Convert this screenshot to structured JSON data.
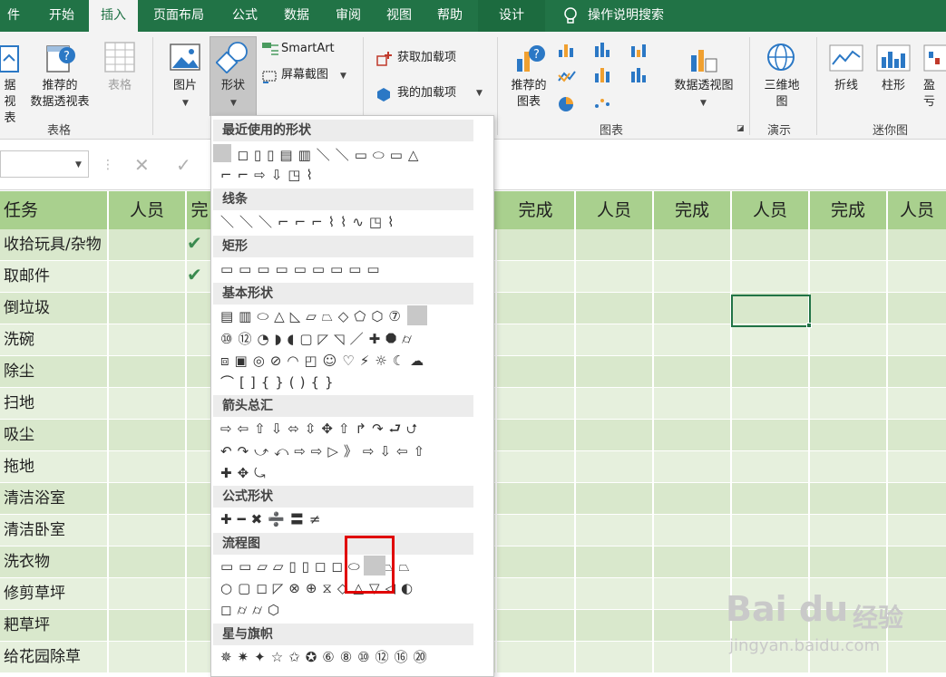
{
  "ribbon_tabs": [
    "件",
    "开始",
    "插入",
    "页面布局",
    "公式",
    "数据",
    "审阅",
    "视图",
    "帮助",
    "设计"
  ],
  "tell_me": "操作说明搜索",
  "ribbon": {
    "tables_group": {
      "pivot_partial_line1": "据",
      "pivot_partial_line2": "视表",
      "recommended_line1": "推荐的",
      "recommended_line2": "数据透视表",
      "table": "表格",
      "label": "表格"
    },
    "illustrations": {
      "picture": "图片",
      "shapes": "形状",
      "smartart": "SmartArt",
      "screenshot": "屏幕截图"
    },
    "addins": {
      "get": "获取加载项",
      "my": "我的加载项"
    },
    "charts": {
      "recommended_line1": "推荐的",
      "recommended_line2": "图表",
      "pivotchart": "数据透视图",
      "label": "图表"
    },
    "tours": {
      "map_line1": "三维地",
      "map_line2": "图",
      "label": "演示"
    },
    "sparklines": {
      "line": "折线",
      "column": "柱形",
      "winloss_partial": "盈亏",
      "label": "迷你图"
    }
  },
  "sheet": {
    "headers": [
      "任务",
      "人员",
      "完成",
      "完成",
      "人员",
      "完成",
      "人员",
      "完成",
      "人员"
    ],
    "tasks": [
      "收拾玩具/杂物",
      "取邮件",
      "倒垃圾",
      "洗碗",
      "除尘",
      "扫地",
      "吸尘",
      "拖地",
      "清洁浴室",
      "清洁卧室",
      "洗衣物",
      "修剪草坪",
      "耙草坪",
      "给花园除草"
    ],
    "check_glyph": "✔"
  },
  "gallery": {
    "sections": [
      "最近使用的形状",
      "线条",
      "矩形",
      "基本形状",
      "箭头总汇",
      "公式形状",
      "流程图",
      "星与旗帜"
    ],
    "rows": {
      "recent1": "◻◻▯▯▤▥＼＼▭⬭▭△",
      "recent2": "⌐⌐⇨⇩◳⌇",
      "lines": "＼＼＼⌐⌐⌐⌇⌇∿◳⌇",
      "rects": "▭▭▭▭▭▭▭▭▭",
      "basic1": "▤▥⬭△◺▱⏢◇⬠⬡⑦⑧",
      "basic2": "⑩⑫◔◗◖▢◸◹／✚⯃⌭",
      "basic3": "⧈▣◎⊘◠◰☺♡⚡☼☾☁",
      "basic4": "⌒[]{}(){}",
      "arrows1": "⇨⇦⇧⇩⬄⇳✥⇧↱↷⮐⮍",
      "arrows2": "↶↷⤻⤺⇨⇨▷》⇨⇩⇦⇧",
      "arrows3": "✚✥⤿",
      "equation": "✚━✖➗〓≠",
      "flow1": "▭▭⏥▱▯▯◻◻⬭⬭⏢⏢",
      "flow2": "○▢◻◸⊗⊕⧖◇△▽◁◐",
      "flow3": "◻⌭⌭⬡",
      "stars": "✵✷✦☆✩✪⑥⑧⑩⑫⑯⑳"
    }
  },
  "watermark": {
    "logo": "Bai du",
    "cn": "经验",
    "url": "jingyan.baidu.com"
  },
  "colors": {
    "accent": "#217346",
    "header_fill": "#a9d08e",
    "row_fill": "#d9e8cc",
    "highlight": "#e00000"
  }
}
